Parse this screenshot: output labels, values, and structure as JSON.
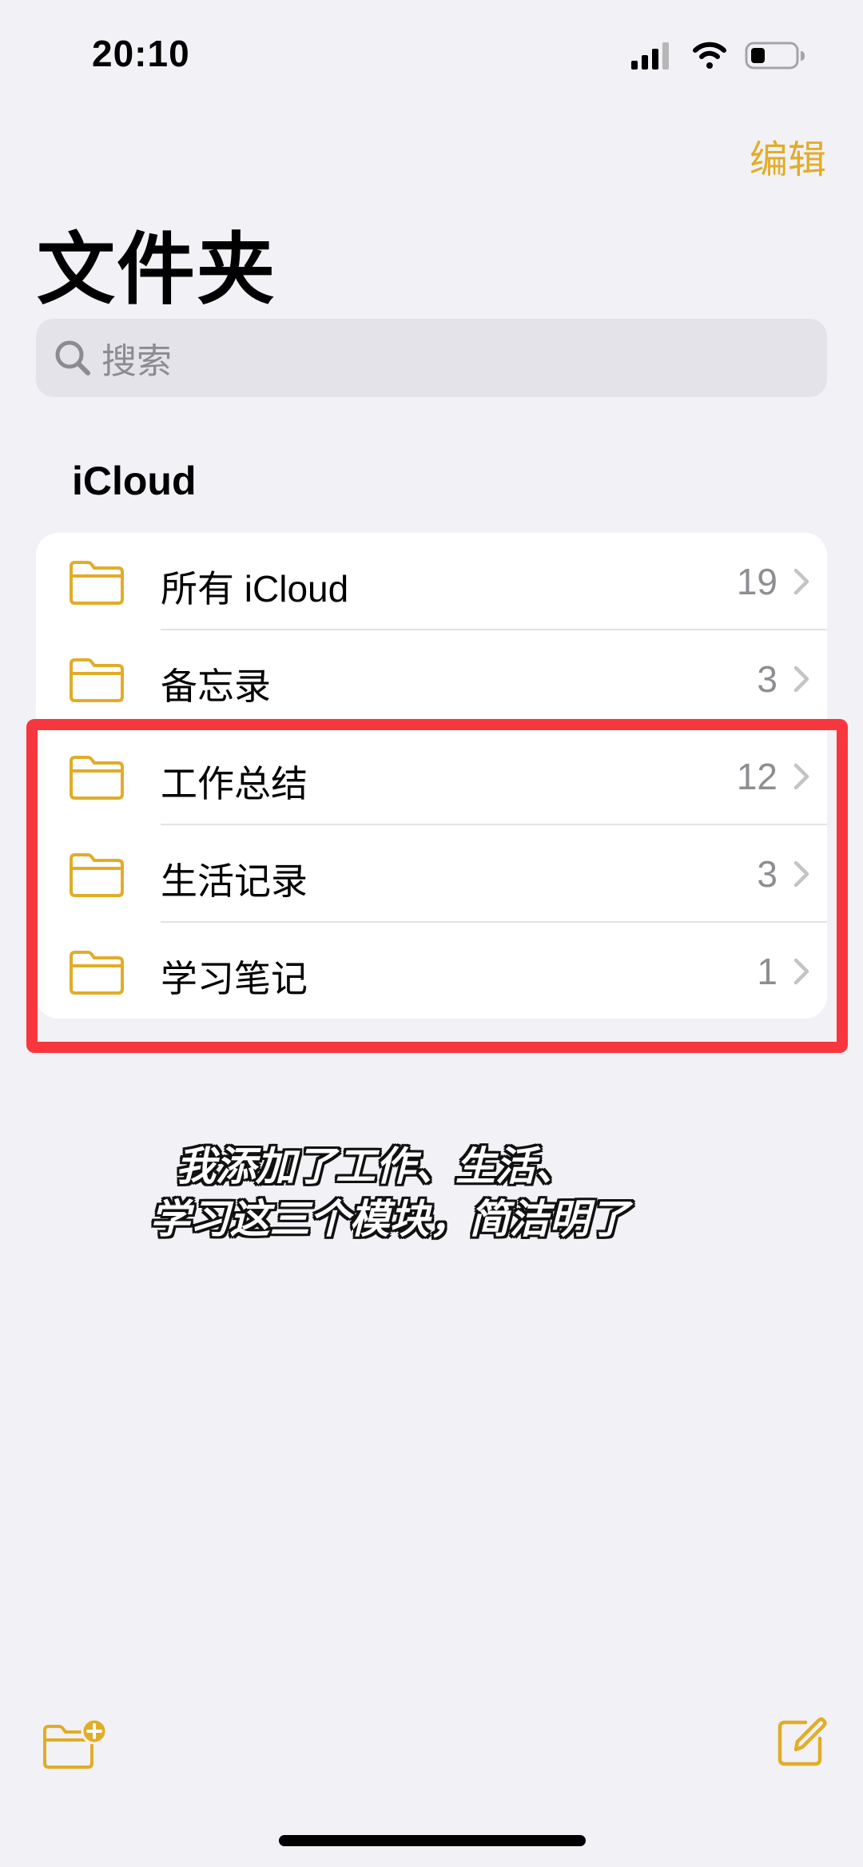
{
  "status_bar": {
    "time": "20:10",
    "icons": [
      "cellular-signal-icon",
      "wifi-icon",
      "battery-icon"
    ]
  },
  "nav": {
    "edit_label": "编辑",
    "title": "文件夹"
  },
  "search": {
    "placeholder": "搜索"
  },
  "section": {
    "title": "iCloud"
  },
  "folders": [
    {
      "label": "所有 iCloud",
      "count": "19"
    },
    {
      "label": "备忘录",
      "count": "3"
    },
    {
      "label": "工作总结",
      "count": "12"
    },
    {
      "label": "生活记录",
      "count": "3"
    },
    {
      "label": "学习笔记",
      "count": "1"
    }
  ],
  "caption": {
    "line1": "我添加了工作、生活、",
    "line2": "学习这三个模块，简洁明了"
  },
  "toolbar": {
    "new_folder_icon": "folder-plus-icon",
    "compose_icon": "compose-icon"
  },
  "colors": {
    "accent": "#E1AD28",
    "background": "#F2F1F6",
    "highlight": "#F7373D"
  }
}
